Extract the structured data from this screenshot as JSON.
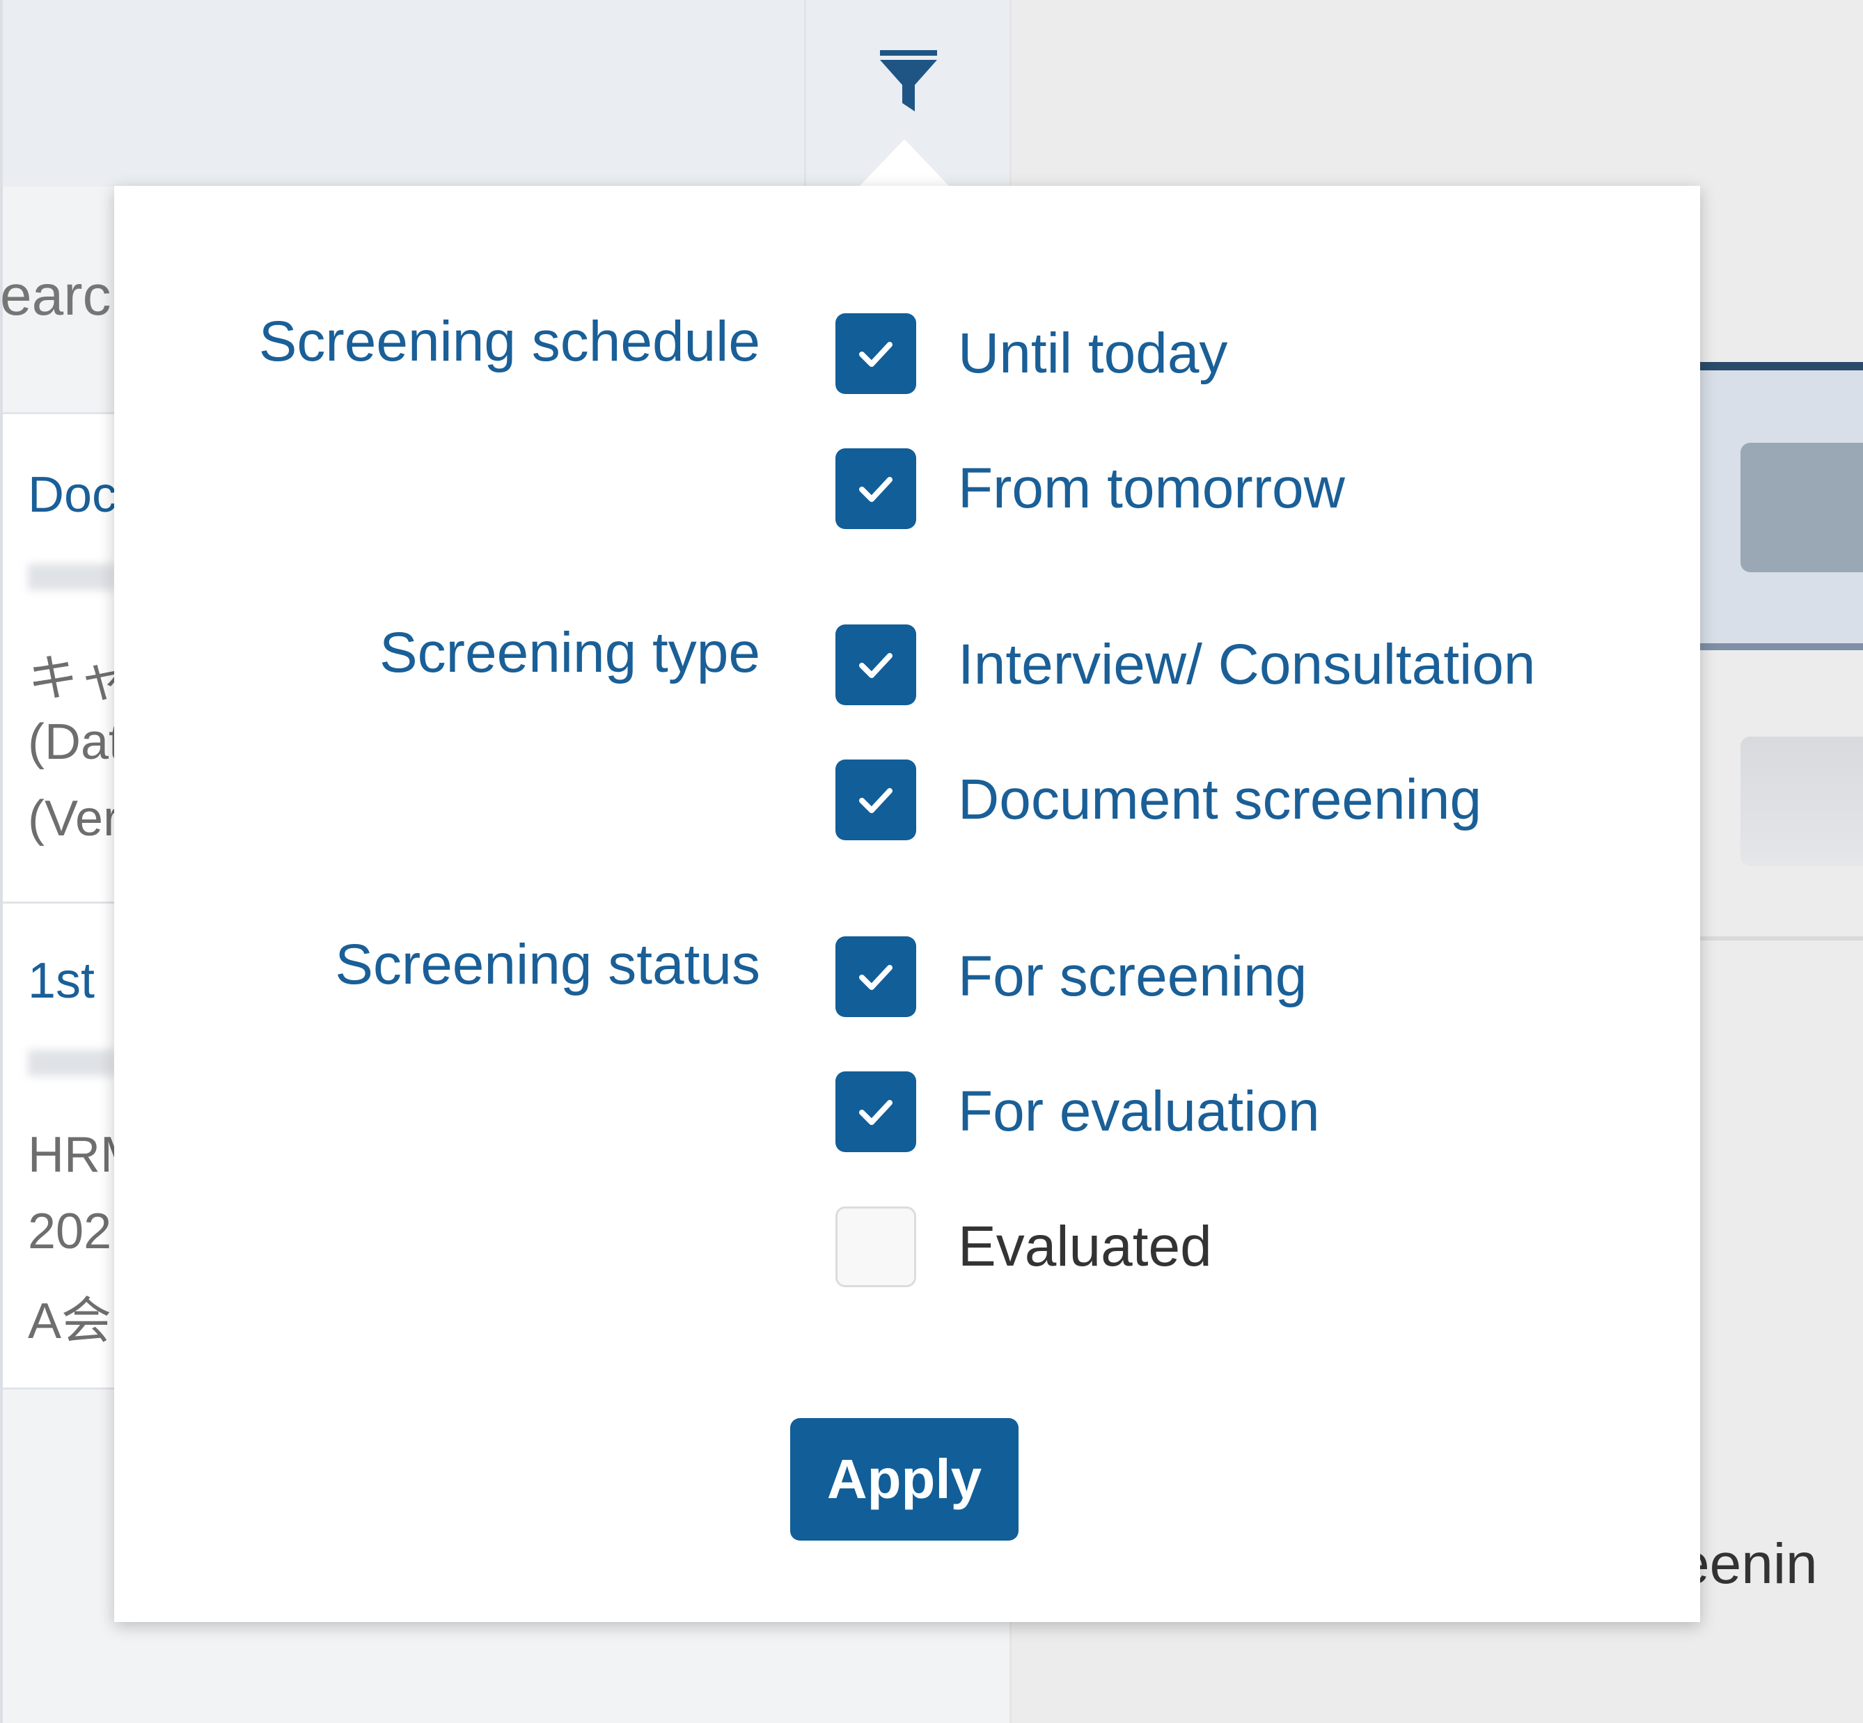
{
  "colors": {
    "accent": "#115e99",
    "link_text": "#1a5f97",
    "dark_text": "#333333",
    "popover_bg": "#ffffff",
    "topbar_bg": "#eaedf1"
  },
  "toolbar": {
    "filter_icon": "filter-funnel-icon"
  },
  "background": {
    "search_fragment": "earcl",
    "card_1": {
      "title": "Doc",
      "line_1": "キャ",
      "line_2": "(Dat",
      "line_3": "(Ver"
    },
    "card_2": {
      "title": "1st",
      "line_1": "HRM",
      "line_2": "202",
      "line_3": "A会"
    },
    "right_text": "eenin"
  },
  "filter": {
    "groups": [
      {
        "label": "Screening schedule",
        "options": [
          {
            "label": "Until today",
            "checked": true
          },
          {
            "label": "From tomorrow",
            "checked": true
          }
        ]
      },
      {
        "label": "Screening type",
        "options": [
          {
            "label": "Interview/ Consultation",
            "checked": true
          },
          {
            "label": "Document screening",
            "checked": true
          }
        ]
      },
      {
        "label": "Screening status",
        "options": [
          {
            "label": "For screening",
            "checked": true
          },
          {
            "label": "For evaluation",
            "checked": true
          },
          {
            "label": "Evaluated",
            "checked": false
          }
        ]
      }
    ],
    "apply_label": "Apply"
  }
}
